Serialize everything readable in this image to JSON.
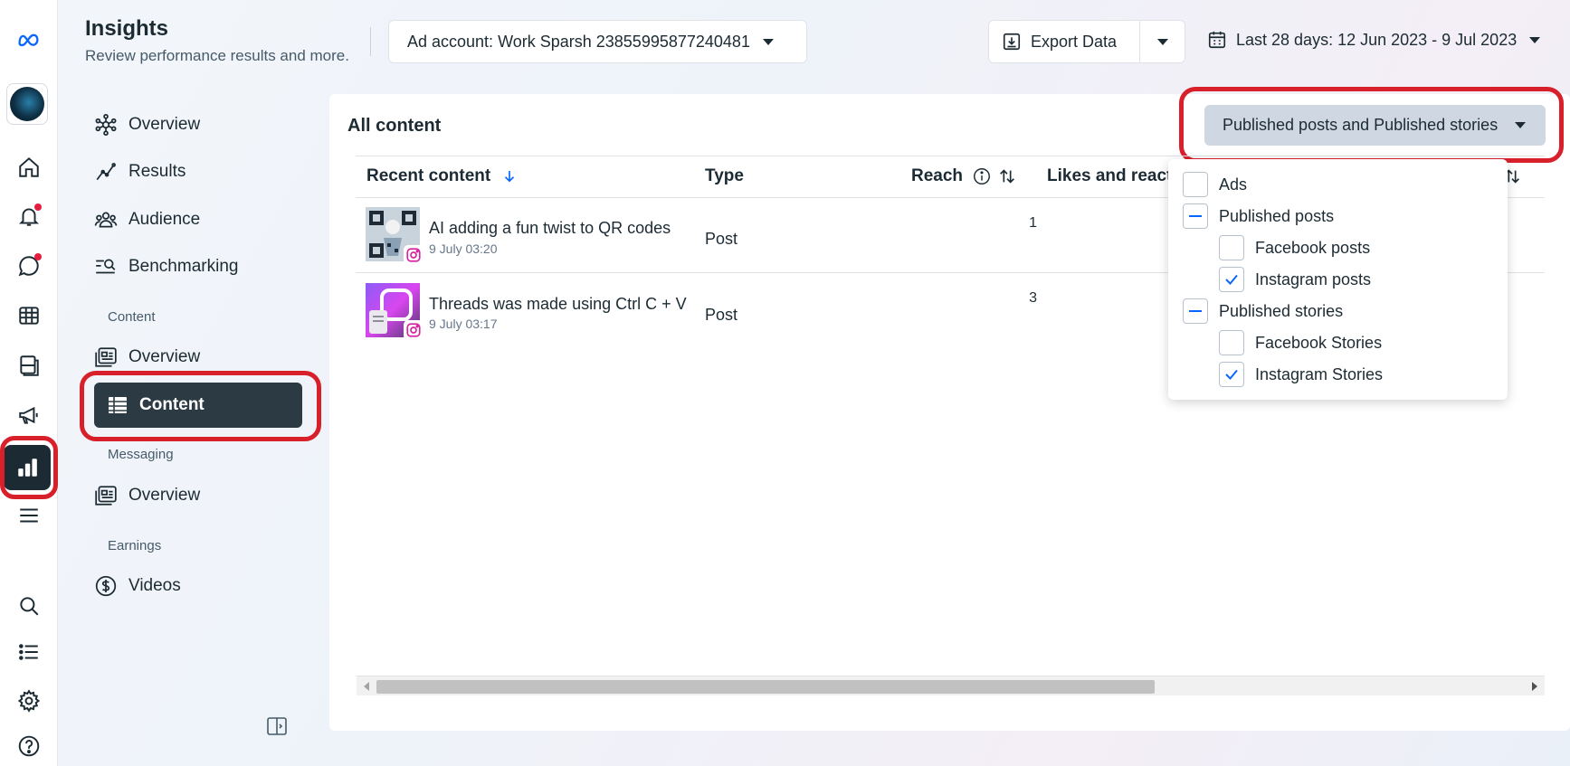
{
  "app": {
    "brand_color": "#0866ff",
    "accent_red": "#d8202b"
  },
  "rail": {
    "items": [
      {
        "name": "home-icon"
      },
      {
        "name": "bell-icon",
        "notification": true
      },
      {
        "name": "chat-icon",
        "notification": true
      },
      {
        "name": "grid-table-icon"
      },
      {
        "name": "pages-icon"
      },
      {
        "name": "megaphone-icon"
      },
      {
        "name": "insights-bar-chart-icon",
        "active": true
      },
      {
        "name": "menu-icon"
      },
      {
        "name": "search-icon"
      },
      {
        "name": "list-icon"
      },
      {
        "name": "gear-icon"
      },
      {
        "name": "help-icon"
      }
    ]
  },
  "header": {
    "title": "Insights",
    "subtitle": "Review performance results and more.",
    "ad_account": "Ad account: Work Sparsh 23855995877240481",
    "export_label": "Export Data",
    "date_range": "Last 28 days: 12 Jun 2023 - 9 Jul 2023"
  },
  "nav": {
    "overview": "Overview",
    "results": "Results",
    "audience": "Audience",
    "benchmarking": "Benchmarking",
    "section_content": "Content",
    "content_overview": "Overview",
    "content": "Content",
    "section_messaging": "Messaging",
    "messaging_overview": "Overview",
    "section_earnings": "Earnings",
    "videos": "Videos"
  },
  "main": {
    "title": "All content",
    "filter_label": "Published posts and Published stories",
    "columns": [
      "Recent content",
      "Type",
      "Reach",
      "Likes and react"
    ],
    "rows": [
      {
        "title": "AI adding a fun twist to QR codes",
        "date": "9 July 03:20",
        "type": "Post",
        "reach": "1"
      },
      {
        "title": "Threads was made using Ctrl C + V",
        "date": "9 July 03:17",
        "type": "Post",
        "reach": "3"
      }
    ]
  },
  "filter_menu": {
    "items": [
      {
        "label": "Ads",
        "state": "unchecked",
        "level": 0
      },
      {
        "label": "Published posts",
        "state": "indeterminate",
        "level": 0
      },
      {
        "label": "Facebook posts",
        "state": "unchecked",
        "level": 1
      },
      {
        "label": "Instagram posts",
        "state": "checked",
        "level": 1
      },
      {
        "label": "Published stories",
        "state": "indeterminate",
        "level": 0
      },
      {
        "label": "Facebook Stories",
        "state": "unchecked",
        "level": 1
      },
      {
        "label": "Instagram Stories",
        "state": "checked",
        "level": 1
      }
    ]
  }
}
